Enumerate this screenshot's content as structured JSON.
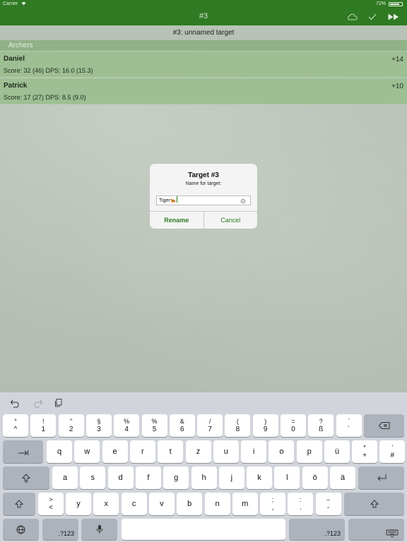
{
  "status_bar": {
    "carrier": "Carrier",
    "battery": "72%"
  },
  "nav": {
    "title": "#3"
  },
  "target": {
    "title": "#3: unnamed target"
  },
  "section": {
    "header": "Archers"
  },
  "archers": [
    {
      "name": "Daniel",
      "score": "Score: 32 (46) DPS: 16.0 (15.3)",
      "delta": "+14"
    },
    {
      "name": "Patrick",
      "score": "Score: 17 (27) DPS: 8.5 (9.0)",
      "delta": "+10"
    }
  ],
  "dialog": {
    "title": "Target #3",
    "message": "Name for target:",
    "input_value": "Tiger🐅",
    "rename_label": "Rename",
    "cancel_label": "Cancel"
  },
  "keyboard": {
    "number_row": [
      {
        "top": "°",
        "bottom": "^"
      },
      {
        "top": "!",
        "bottom": "1"
      },
      {
        "top": "″",
        "bottom": "2"
      },
      {
        "top": "§",
        "bottom": "3"
      },
      {
        "top": "%",
        "bottom": "4"
      },
      {
        "top": "%",
        "bottom": "5"
      },
      {
        "top": "&",
        "bottom": "6"
      },
      {
        "top": "/",
        "bottom": "7"
      },
      {
        "top": "(",
        "bottom": "8"
      },
      {
        "top": ")",
        "bottom": "9"
      },
      {
        "top": "=",
        "bottom": "0"
      },
      {
        "top": "?",
        "bottom": "ß"
      },
      {
        "top": "`",
        "bottom": "´"
      }
    ],
    "row1": [
      "q",
      "w",
      "e",
      "r",
      "t",
      "z",
      "u",
      "i",
      "o",
      "p",
      "ü"
    ],
    "row1_extra": [
      {
        "top": "*",
        "bottom": "+"
      },
      {
        "top": "’",
        "bottom": "#"
      }
    ],
    "row2": [
      "a",
      "s",
      "d",
      "f",
      "g",
      "h",
      "j",
      "k",
      "l",
      "ö",
      "ä"
    ],
    "row3_lt": {
      "top": ">",
      "bottom": "<"
    },
    "row3": [
      "y",
      "x",
      "c",
      "v",
      "b",
      "n",
      "m"
    ],
    "row3_punct": [
      {
        "top": ";",
        "bottom": ","
      },
      {
        "top": ":",
        "bottom": "."
      },
      {
        "top": "–",
        "bottom": "-"
      }
    ],
    "numbers_label": ".?123",
    "numbers_label_right": ".?123"
  }
}
